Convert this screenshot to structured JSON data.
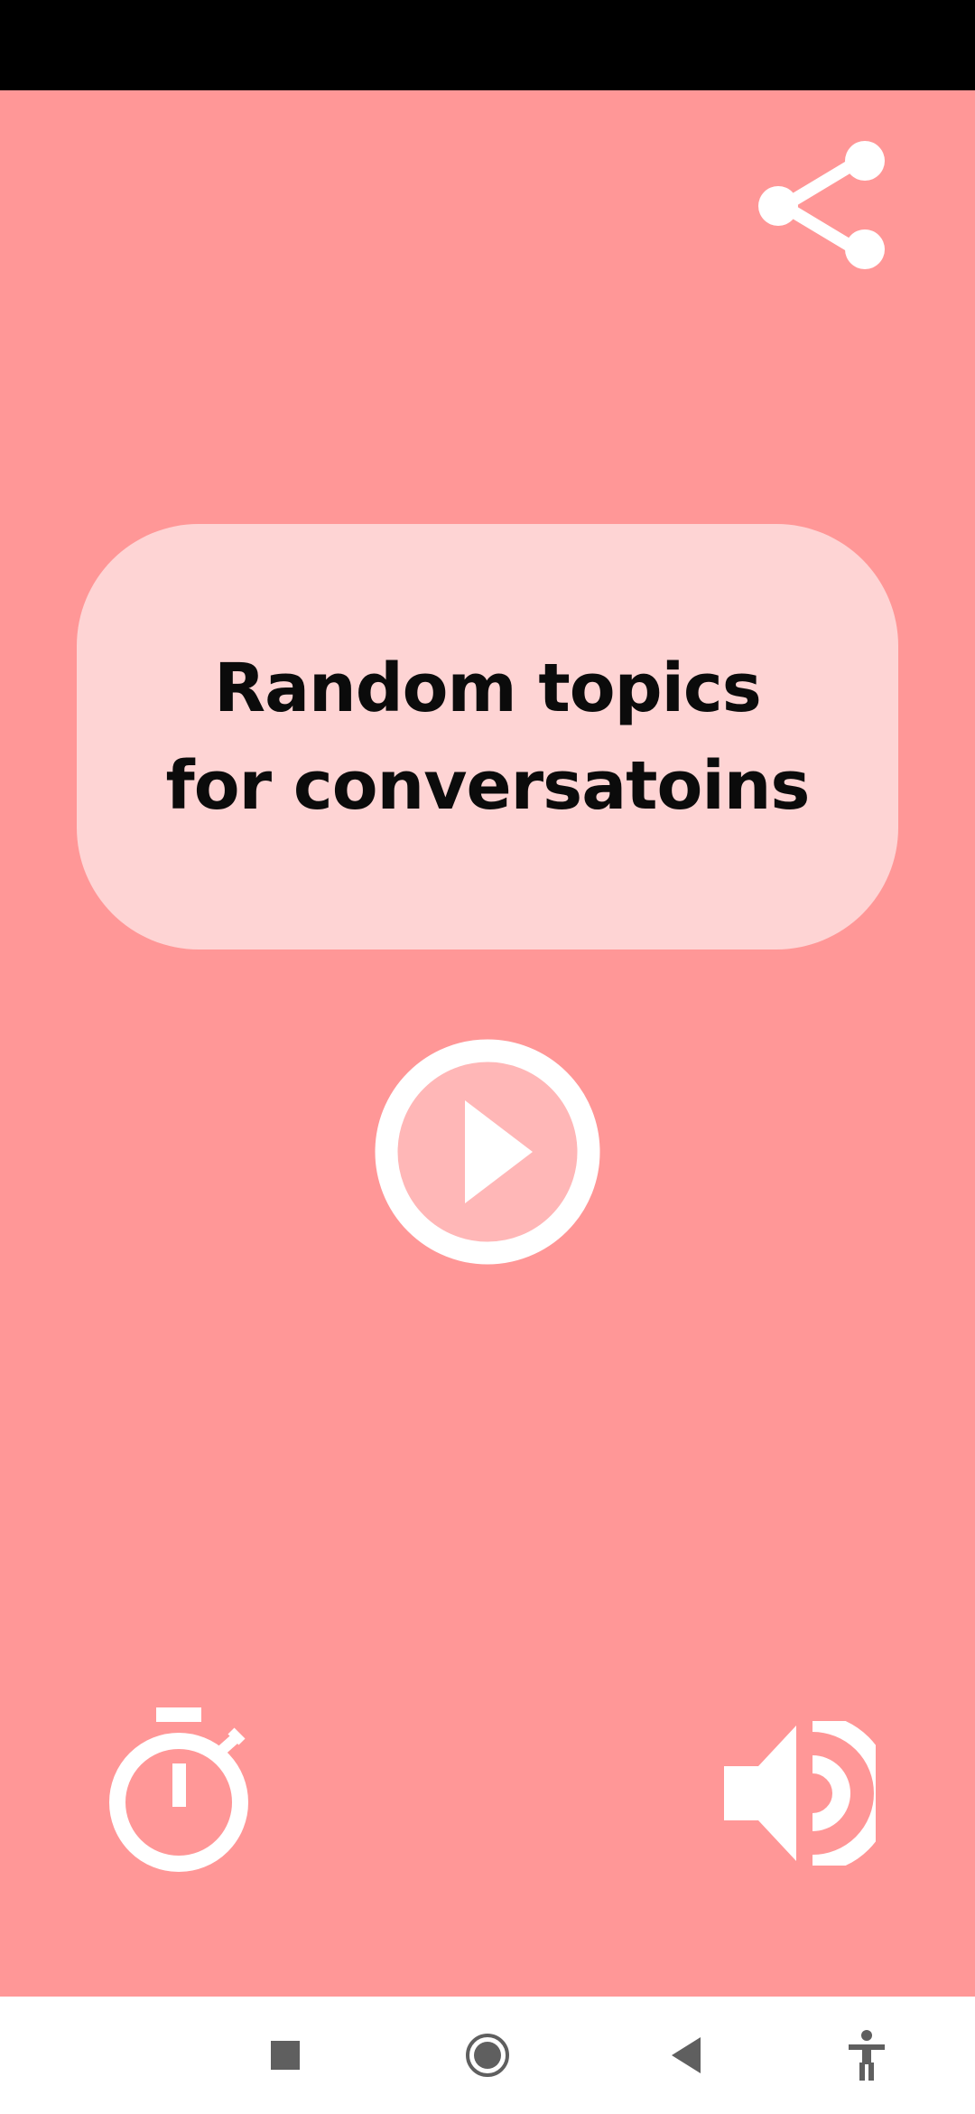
{
  "app": {
    "title_lines": [
      "Random topics",
      "for conversatoins"
    ]
  },
  "toolbar": {
    "share_icon": "share-icon",
    "play_icon": "play-icon",
    "timer_icon": "timer-icon",
    "sound_icon": "volume-icon"
  },
  "nav": {
    "recents_icon": "square-icon",
    "home_icon": "circle-icon",
    "back_icon": "triangle-back-icon",
    "accessibility_icon": "accessibility-icon"
  },
  "colors": {
    "background": "#ff9797",
    "card": "#fed4d4",
    "icon": "#ffffff",
    "status_bar": "#000000",
    "nav_bar": "#ffffff",
    "nav_icon": "#5f5f5f"
  }
}
